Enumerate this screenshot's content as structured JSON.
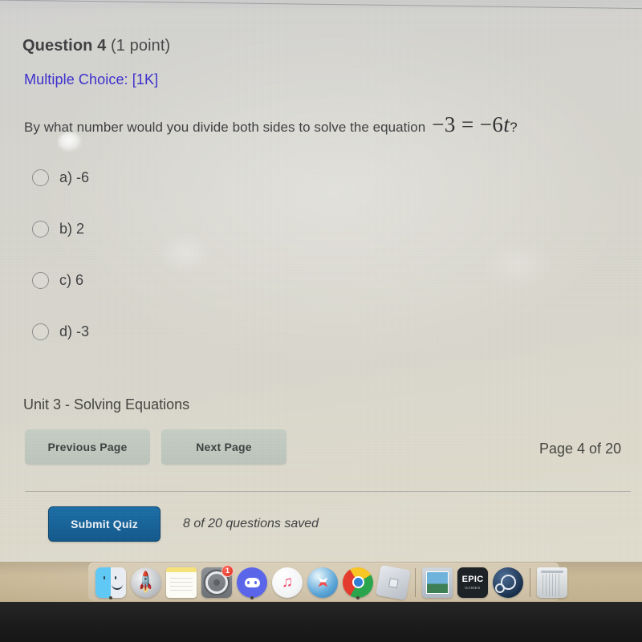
{
  "quiz": {
    "question_number_label": "Question 4",
    "points_label": "(1 point)",
    "type_label": "Multiple Choice: [1K]",
    "prompt": "By what number would you divide both sides to solve the equation",
    "equation": {
      "left": "−3",
      "operator": "=",
      "right_coefficient": "−6",
      "right_variable": "t",
      "trailing": "?"
    },
    "options": [
      {
        "letter": "a)",
        "value": "-6",
        "selected": false
      },
      {
        "letter": "b)",
        "value": "2",
        "selected": false
      },
      {
        "letter": "c)",
        "value": "6",
        "selected": false
      },
      {
        "letter": "d)",
        "value": "-3",
        "selected": false
      }
    ],
    "unit_label": "Unit 3 - Solving Equations",
    "previous_page_label": "Previous Page",
    "next_page_label": "Next Page",
    "page_indicator": "Page 4 of 20",
    "submit_label": "Submit Quiz",
    "saved_status": "8 of 20 questions saved",
    "colors": {
      "link": "#3b2fcf",
      "submit_button": "#14598c",
      "nav_button": "#bcc5bc",
      "page_background": "#d6d5ce",
      "text": "#3f4042"
    }
  },
  "dock": {
    "items": [
      {
        "name": "finder",
        "label": "Finder",
        "running": true,
        "badge": null
      },
      {
        "name": "launchpad",
        "label": "Launchpad",
        "running": false,
        "badge": null
      },
      {
        "name": "notes",
        "label": "Notes",
        "running": false,
        "badge": null
      },
      {
        "name": "preferences",
        "label": "System Preferences",
        "running": false,
        "badge": "1"
      },
      {
        "name": "discord",
        "label": "Discord",
        "running": true,
        "badge": null
      },
      {
        "name": "music",
        "label": "Music",
        "running": false,
        "badge": null
      },
      {
        "name": "safari",
        "label": "Safari",
        "running": false,
        "badge": null
      },
      {
        "name": "chrome",
        "label": "Google Chrome",
        "running": true,
        "badge": null
      },
      {
        "name": "roblox",
        "label": "Roblox",
        "running": false,
        "badge": null
      },
      {
        "name": "preview",
        "label": "Preview",
        "running": false,
        "badge": null
      },
      {
        "name": "epic",
        "label": "Epic Games",
        "running": false,
        "badge": null
      },
      {
        "name": "steam",
        "label": "Steam",
        "running": false,
        "badge": null
      },
      {
        "name": "trash",
        "label": "Trash",
        "running": false,
        "badge": null
      }
    ],
    "epic_word": "EPIC",
    "epic_sub": "GAMES"
  }
}
